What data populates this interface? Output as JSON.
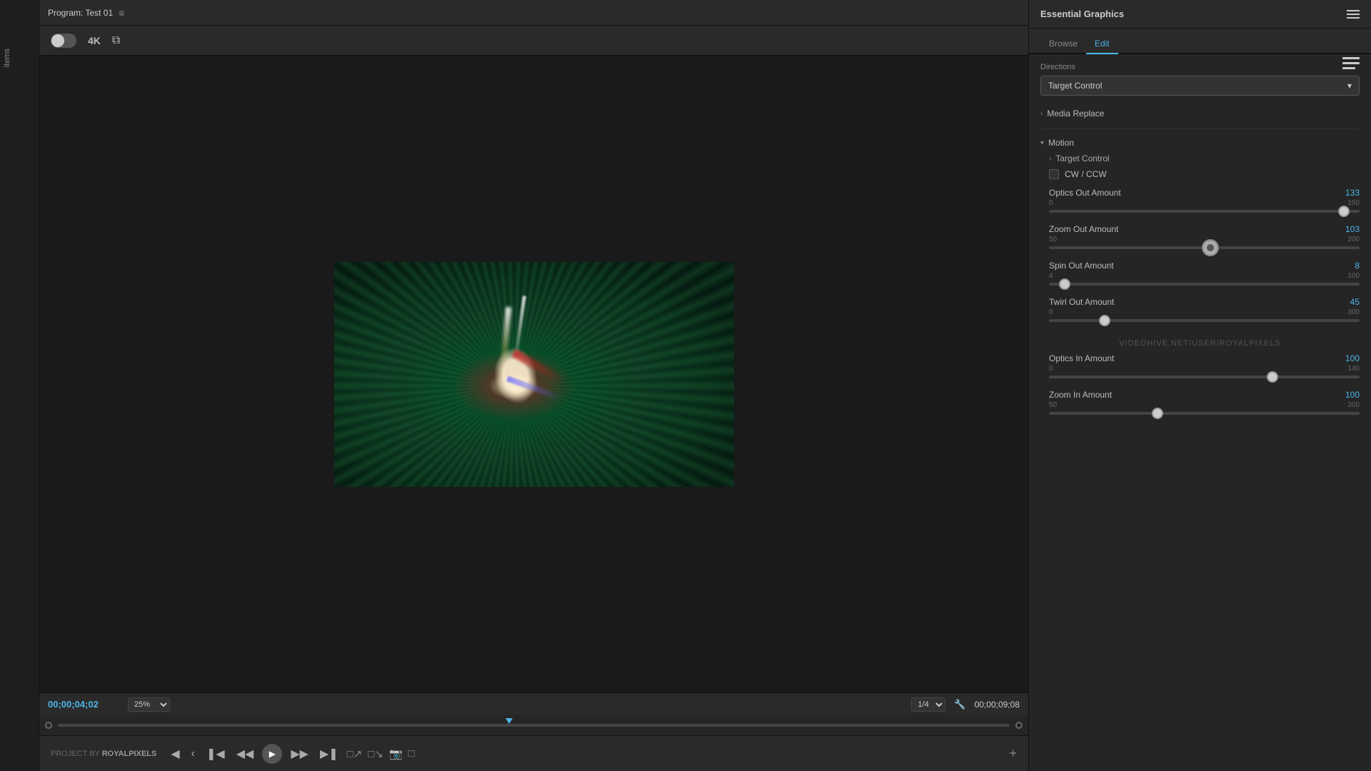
{
  "program_monitor": {
    "title": "Program: Test 01",
    "menu_icon": "≡",
    "controls": {
      "resolution_label": "4K",
      "compare_icon": "⧉"
    },
    "timecode": {
      "current": "00;00;04;02",
      "zoom": "25%",
      "fraction": "1/4",
      "total": "00;00;09;08"
    },
    "transport": {
      "project_credit_pre": "PROJECT BY",
      "project_credit_name": "ROYALPIXELS"
    }
  },
  "essential_graphics": {
    "title": "Essential Graphics",
    "menu_icon": "≡",
    "tabs": [
      {
        "label": "Browse",
        "active": false
      },
      {
        "label": "Edit",
        "active": true
      }
    ],
    "directions": {
      "label": "Directions",
      "value": "Target Control",
      "arrow": "▾"
    },
    "media_replace": {
      "label": "Media Replace",
      "arrow": "›"
    },
    "motion": {
      "label": "Motion",
      "arrow": "▾",
      "target_control": {
        "label": "Target Control",
        "arrow": "›"
      },
      "cw_ccw": {
        "label": "CW / CCW"
      },
      "sliders": [
        {
          "name": "Optics Out Amount",
          "value": "133",
          "min": "0",
          "max": "150",
          "thumb_pct": 95
        },
        {
          "name": "Zoom Out Amount",
          "value": "103",
          "min": "50",
          "max": "200",
          "thumb_pct": 52,
          "large_thumb": true
        },
        {
          "name": "Spin Out Amount",
          "value": "8",
          "min": "4",
          "max": "100",
          "thumb_pct": 5
        },
        {
          "name": "Twirl Out Amount",
          "value": "45",
          "min": "0",
          "max": "300",
          "thumb_pct": 18
        },
        {
          "name": "Optics In Amount",
          "value": "100",
          "min": "0",
          "max": "140",
          "thumb_pct": 72
        },
        {
          "name": "Zoom In Amount",
          "value": "100",
          "min": "50",
          "max": "200",
          "thumb_pct": 35
        }
      ]
    },
    "watermark": "VIDEOHIVE.NET/USER/ROYALPIXELS"
  }
}
